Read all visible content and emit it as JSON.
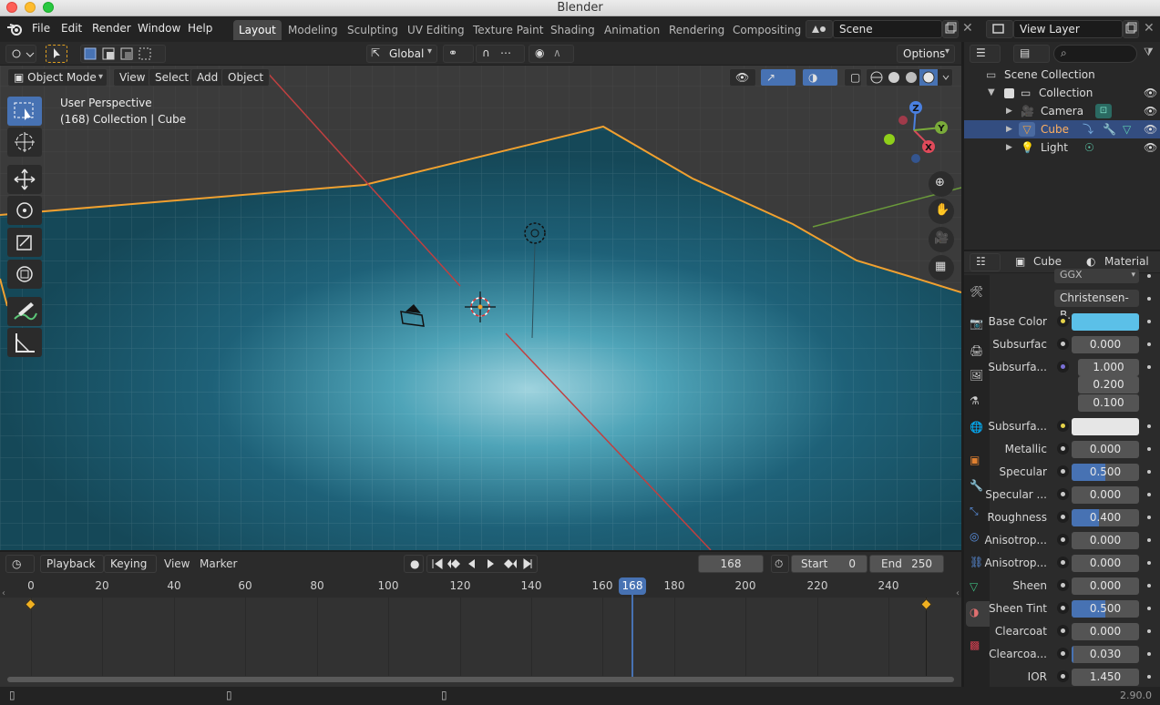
{
  "window": {
    "title": "Blender",
    "version": "2.90.0"
  },
  "menu": [
    "File",
    "Edit",
    "Render",
    "Window",
    "Help"
  ],
  "workspaces": [
    "Layout",
    "Modeling",
    "Sculpting",
    "UV Editing",
    "Texture Paint",
    "Shading",
    "Animation",
    "Rendering",
    "Compositing"
  ],
  "active_workspace": "Layout",
  "scene": {
    "name": "Scene",
    "view_layer": "View Layer"
  },
  "tool_header": {
    "orientation": "Global",
    "options": "Options"
  },
  "viewport_header": {
    "mode": "Object Mode",
    "view": "View",
    "select": "Select",
    "add": "Add",
    "object": "Object"
  },
  "viewport_info": {
    "perspective": "User Perspective",
    "collection": "(168) Collection | Cube"
  },
  "gizmo": {
    "x": "X",
    "y": "Y",
    "z": "Z"
  },
  "timeline": {
    "playback": "Playback",
    "keying": "Keying",
    "view": "View",
    "marker": "Marker",
    "current_frame": "168",
    "start_label": "Start",
    "start": "0",
    "end_label": "End",
    "end": "250",
    "ticks": [
      "0",
      "20",
      "40",
      "60",
      "80",
      "100",
      "120",
      "140",
      "160",
      "180",
      "200",
      "220",
      "240"
    ],
    "playhead": "168"
  },
  "outliner": {
    "scene_collection": "Scene Collection",
    "collection": "Collection",
    "items": [
      "Camera",
      "Cube",
      "Light"
    ]
  },
  "properties": {
    "object": "Cube",
    "material": "Material",
    "distribution": "GGX",
    "subsurface_method": "Christensen-B...",
    "rows": [
      {
        "label": "Base Color",
        "value": "",
        "dot": "yellow",
        "color": "#5bc0e8"
      },
      {
        "label": "Subsurfac",
        "value": "0.000"
      },
      {
        "label": "Subsurfa...",
        "value": "1.000",
        "dot": "purple"
      },
      {
        "label": "",
        "value": "0.200"
      },
      {
        "label": "",
        "value": "0.100"
      },
      {
        "label": "Subsurfa...",
        "value": "",
        "dot": "yellow",
        "color": "#e6e6e6"
      },
      {
        "label": "Metallic",
        "value": "0.000"
      },
      {
        "label": "Specular",
        "value": "0.500",
        "fill": 0.5
      },
      {
        "label": "Specular ...",
        "value": "0.000"
      },
      {
        "label": "Roughness",
        "value": "0.400",
        "fill": 0.4
      },
      {
        "label": "Anisotrop...",
        "value": "0.000"
      },
      {
        "label": "Anisotrop...",
        "value": "0.000"
      },
      {
        "label": "Sheen",
        "value": "0.000"
      },
      {
        "label": "Sheen Tint",
        "value": "0.500",
        "fill": 0.5
      },
      {
        "label": "Clearcoat",
        "value": "0.000"
      },
      {
        "label": "Clearcoa...",
        "value": "0.030",
        "fill": 0.03
      },
      {
        "label": "IOR",
        "value": "1.450"
      }
    ]
  }
}
